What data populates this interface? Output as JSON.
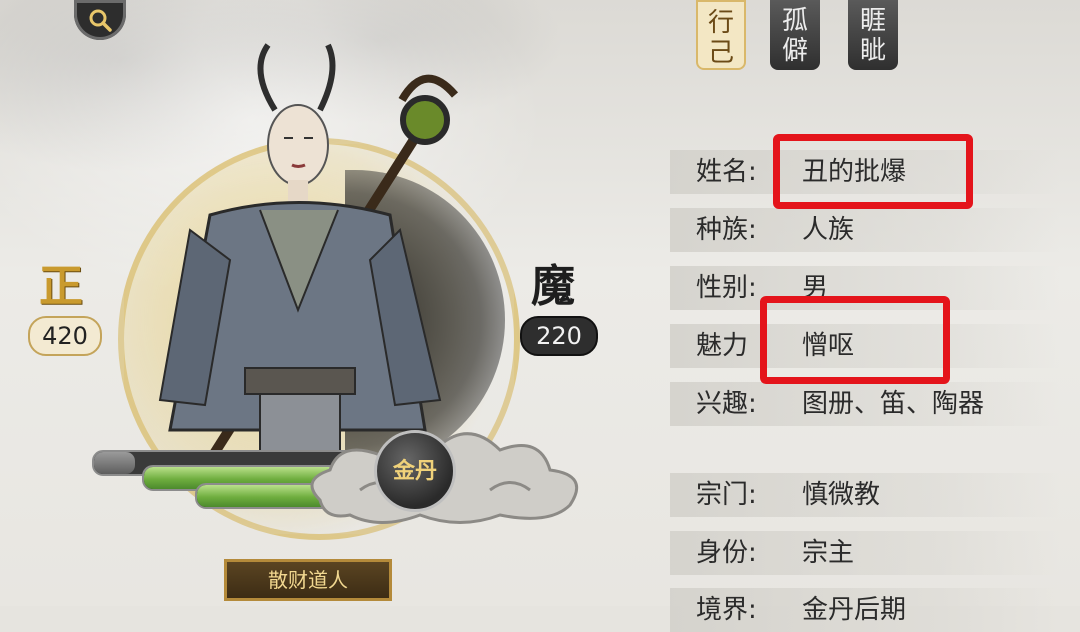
{
  "tabs": [
    {
      "label": "行\n己",
      "active": true
    },
    {
      "label": "孤\n僻",
      "active": false
    },
    {
      "label": "睚\n眦",
      "active": false
    }
  ],
  "alignment": {
    "left_label": "正",
    "left_value": "420",
    "right_label": "魔",
    "right_value": "220"
  },
  "status_bars": [
    {
      "id": "bar1",
      "level": 0.15
    },
    {
      "id": "bar2",
      "level": 1.0
    },
    {
      "id": "bar3",
      "level": 1.0
    }
  ],
  "badge": {
    "text": "金丹",
    "icon": "golden-core-badge"
  },
  "character_title": "散财道人",
  "profile": [
    {
      "label": "姓名:",
      "value": "丑的批爆"
    },
    {
      "label": "种族:",
      "value": "人族"
    },
    {
      "label": "性别:",
      "value": "男"
    },
    {
      "label": "魅力",
      "value": "憎呕"
    },
    {
      "label": "兴趣:",
      "value": "图册、笛、陶器"
    },
    {
      "label": "宗门:",
      "value": "慎微教"
    },
    {
      "label": "身份:",
      "value": "宗主"
    },
    {
      "label": "境界:",
      "value": "金丹后期"
    }
  ],
  "colors": {
    "highlight": "#e4141b",
    "gold": "#c99a2e",
    "accent_green": "#6fae3f"
  }
}
